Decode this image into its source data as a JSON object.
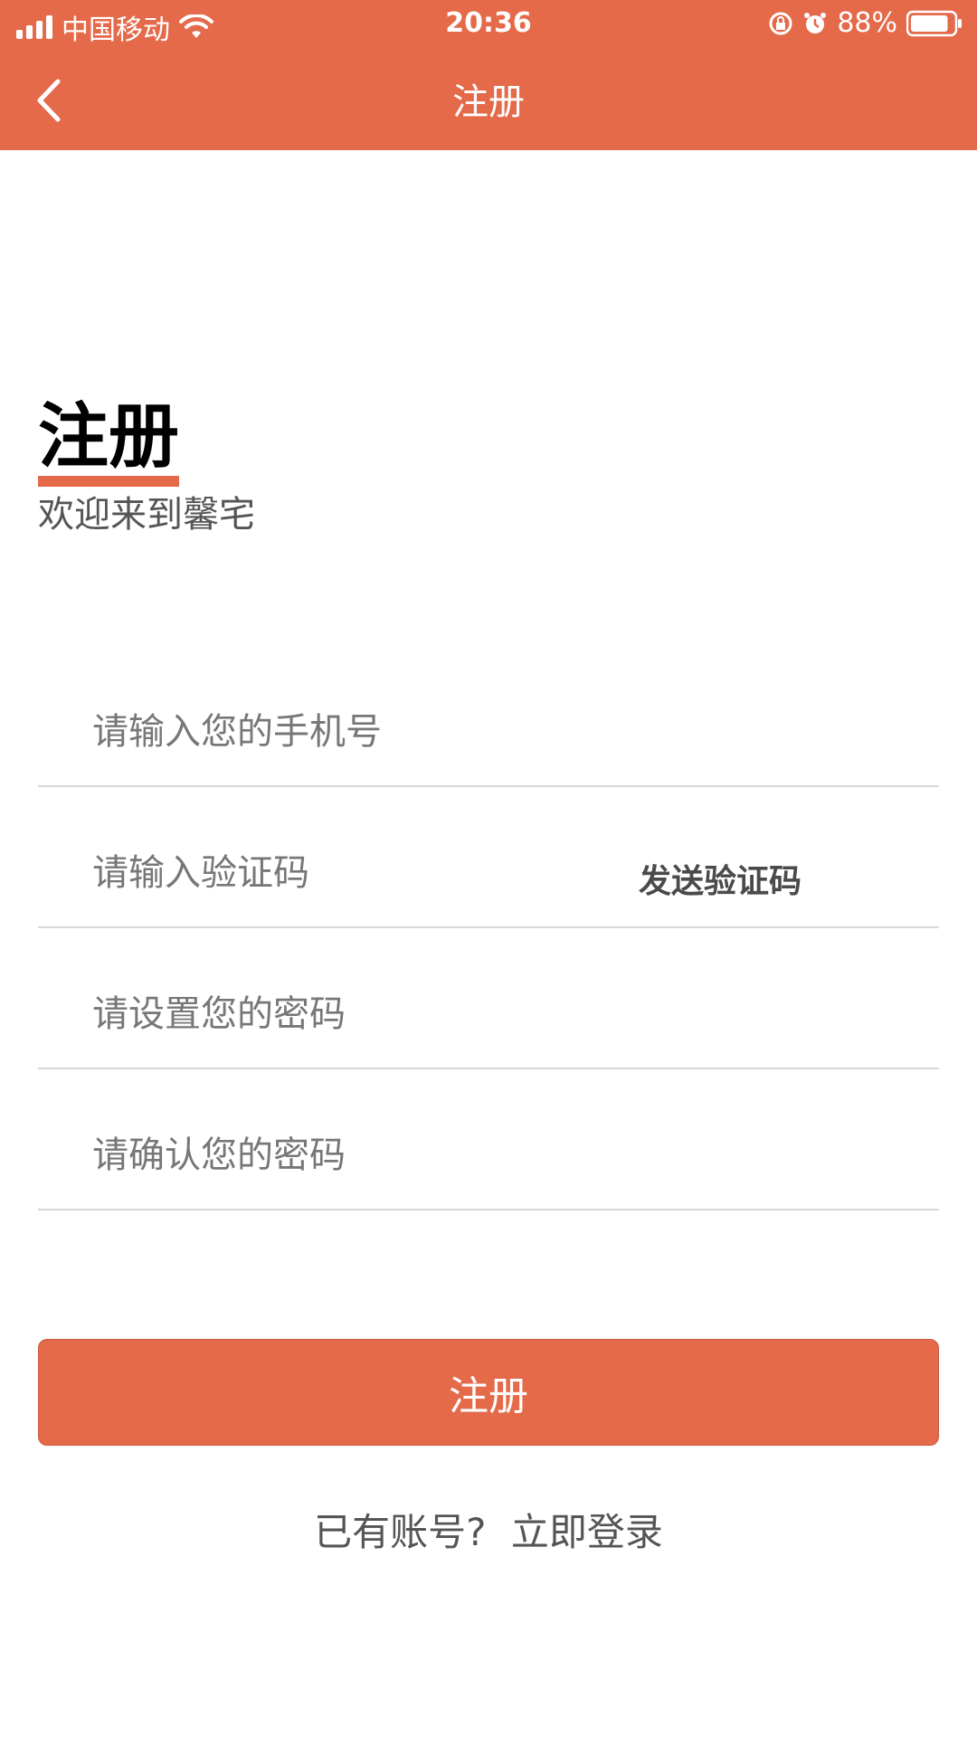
{
  "status_bar": {
    "carrier": "中国移动",
    "time": "20:36",
    "battery": "88%",
    "battery_level": 0.88
  },
  "nav": {
    "title": "注册",
    "back_icon": "chevron-left-icon"
  },
  "header": {
    "title": "注册",
    "subtitle": "欢迎来到馨宅"
  },
  "form": {
    "phone_placeholder": "请输入您的手机号",
    "code_placeholder": "请输入验证码",
    "send_code_label": "发送验证码",
    "password_placeholder": "请设置您的密码",
    "confirm_placeholder": "请确认您的密码",
    "submit_label": "注册"
  },
  "footer": {
    "has_account_text": "已有账号?",
    "login_link": "立即登录"
  },
  "colors": {
    "accent": "#E46A4A"
  }
}
